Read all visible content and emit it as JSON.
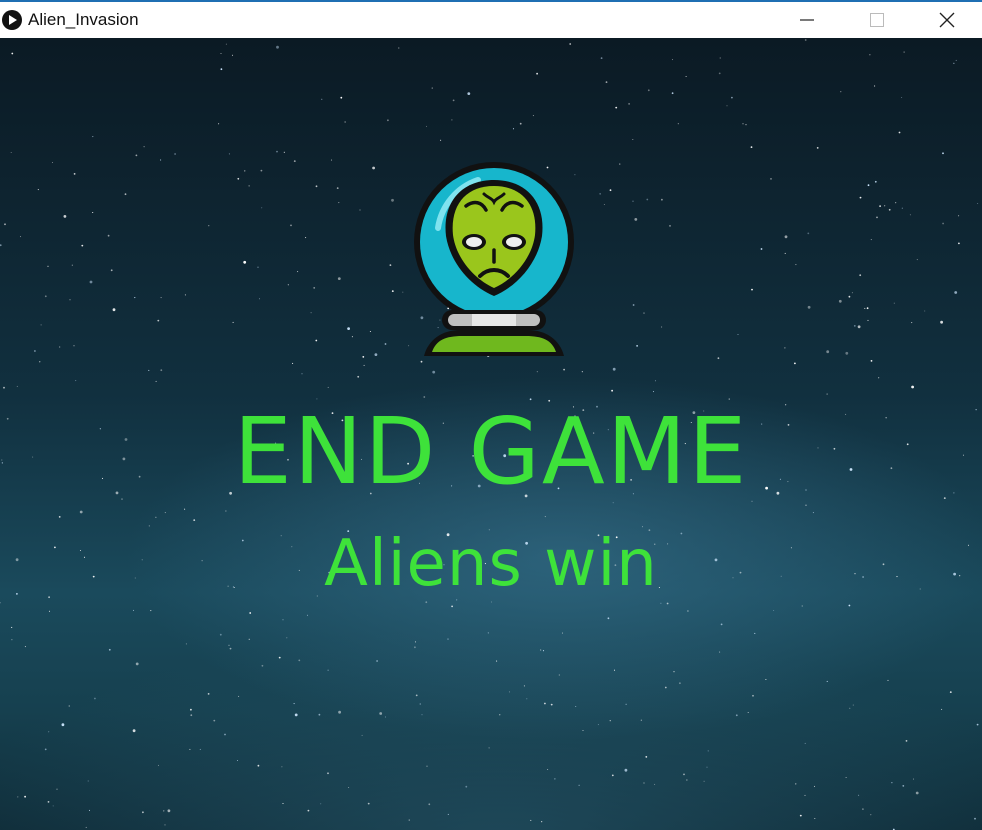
{
  "window": {
    "title": "Alien_Invasion",
    "controls": [
      "minimize",
      "maximize",
      "close"
    ]
  },
  "game": {
    "title": "END GAME",
    "subtitle": "Aliens win",
    "icon": "alien-astronaut-icon",
    "text_color": "#3ee23a"
  },
  "colors": {
    "titlebar_bg": "#ffffff",
    "titlebar_border": "#1f6fb3",
    "sky_dark": "#0b1a24",
    "sky_mid": "#1a4a5c"
  }
}
